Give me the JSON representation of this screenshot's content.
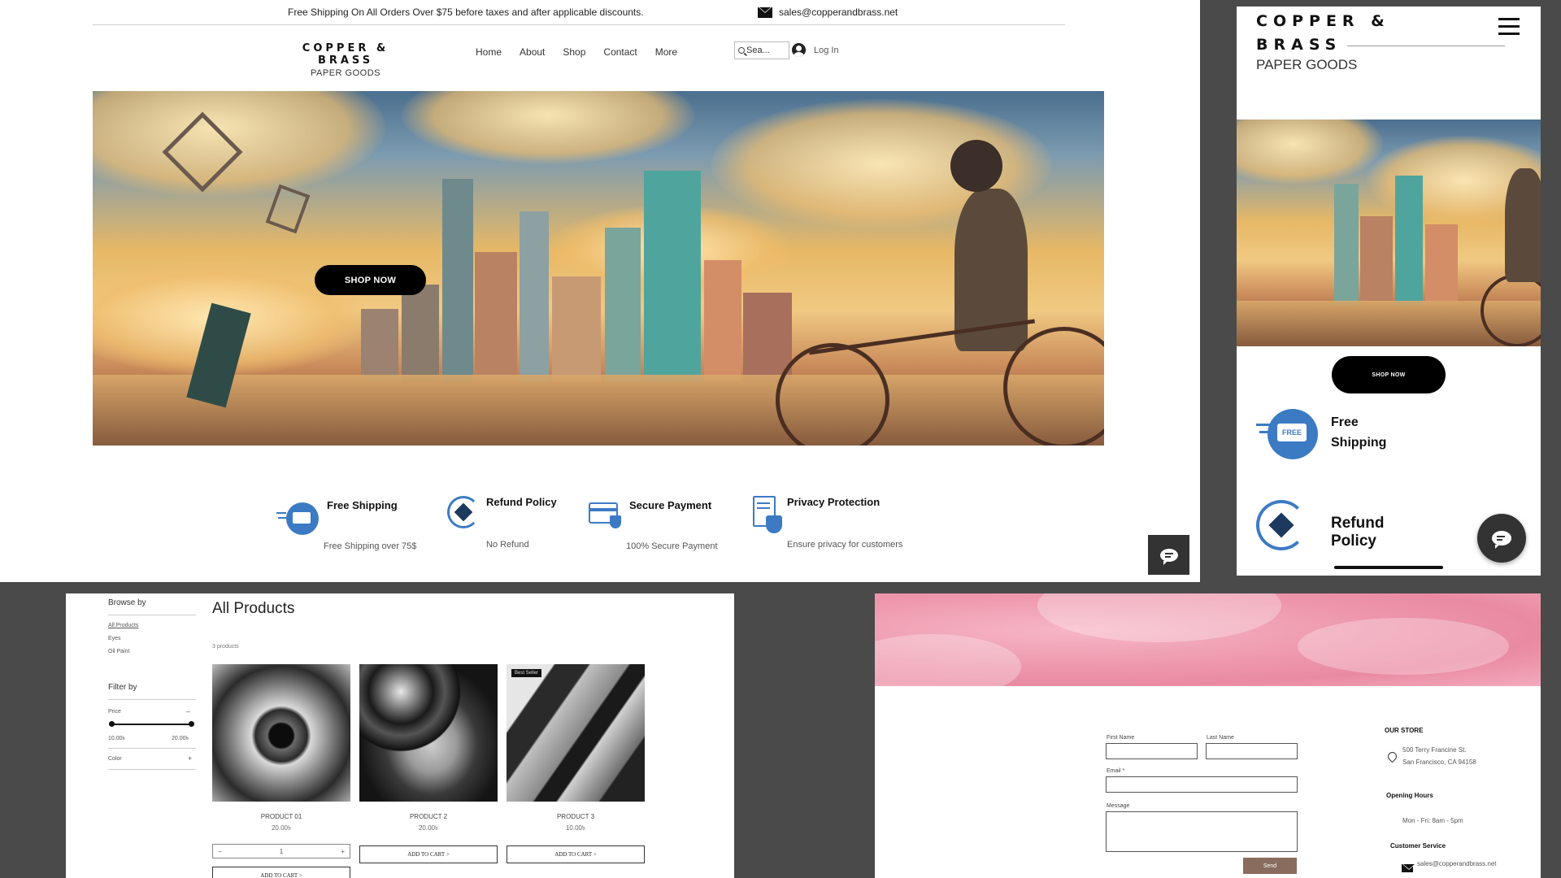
{
  "desktop": {
    "announcement": "Free Shipping On All Orders Over $75 before taxes and after applicable discounts.",
    "email": "sales@copperandbrass.net",
    "brand": {
      "line1": "COPPER & BRASS",
      "line2": "PAPER GOODS"
    },
    "nav": [
      {
        "label": "Home"
      },
      {
        "label": "About"
      },
      {
        "label": "Shop"
      },
      {
        "label": "Contact"
      },
      {
        "label": "More"
      }
    ],
    "search_placeholder": "Sea...",
    "login_label": "Log In",
    "hero_button": "SHOP NOW",
    "features": [
      {
        "title": "Free Shipping",
        "subtitle": "Free Shipping over 75$",
        "icon": "truck-icon"
      },
      {
        "title": "Refund Policy",
        "subtitle": "No Refund",
        "icon": "refund-icon"
      },
      {
        "title": "Secure Payment",
        "subtitle": "100% Secure Payment",
        "icon": "card-shield-icon"
      },
      {
        "title": "Privacy Protection",
        "subtitle": "Ensure privacy for customers",
        "icon": "document-lock-icon"
      }
    ],
    "chat_icon": "chat-icon"
  },
  "mobile": {
    "brand": {
      "line1": "COPPER &",
      "line1b": "BRASS",
      "line2": "PAPER GOODS"
    },
    "hero_button": "SHOP NOW",
    "features": [
      {
        "title_a": "Free",
        "title_b": "Shipping",
        "badge": "FREE"
      },
      {
        "title": "Refund Policy"
      }
    ]
  },
  "shop": {
    "browse_by": "Browse by",
    "browse_links": [
      "All Products",
      "Eyes",
      "Oil Paint"
    ],
    "filter_by": "Filter by",
    "price_label": "Price",
    "price_toggle": "–",
    "price_min": "10.00৳",
    "price_max": "20.00৳",
    "color_label": "Color",
    "color_toggle": "+",
    "title": "All Products",
    "count": "3 products",
    "products": [
      {
        "name": "PRODUCT 01",
        "price": "20.00৳",
        "badge": ""
      },
      {
        "name": "PRODUCT 2",
        "price": "20.00৳",
        "badge": ""
      },
      {
        "name": "PRODUCT 3",
        "price": "10.00৳",
        "badge": "Best Seller"
      }
    ],
    "qty": {
      "minus": "−",
      "value": "1",
      "plus": "+"
    },
    "add_to_cart": "ADD TO CART >"
  },
  "contact": {
    "first_name": "First Name",
    "last_name": "Last Name",
    "email": "Email *",
    "message": "Message",
    "send": "Send",
    "store_heading": "OUR STORE",
    "address_1": "500 Terry Francine St.",
    "address_2": "San Francisco, CA 94158",
    "hours_heading": "Opening Hours",
    "hours": "Mon - Fri: 8am - 5pm",
    "service_heading": "Customer Service",
    "service_email": "sales@copperandbrass.net"
  }
}
